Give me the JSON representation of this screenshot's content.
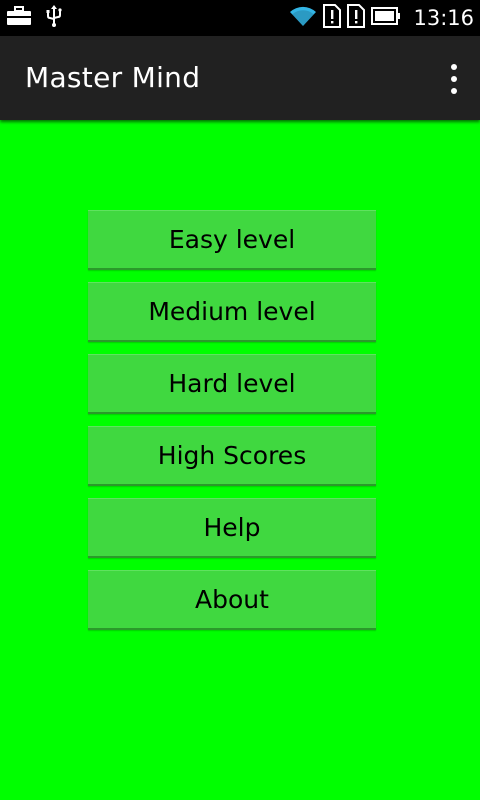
{
  "status_bar": {
    "time": "13:16",
    "left_icons": [
      "briefcase-icon",
      "usb-icon"
    ],
    "right_icons": [
      "wifi-icon",
      "sim-alert-icon",
      "sim-alert-icon",
      "battery-icon"
    ]
  },
  "action_bar": {
    "title": "Master Mind",
    "overflow_icon": "overflow-menu-icon"
  },
  "menu": {
    "items": [
      {
        "label": "Easy level"
      },
      {
        "label": "Medium level"
      },
      {
        "label": "Hard level"
      },
      {
        "label": "High Scores"
      },
      {
        "label": "Help"
      },
      {
        "label": "About"
      }
    ]
  },
  "colors": {
    "background": "#00ff00",
    "button": "#40d840",
    "action_bar": "#212121",
    "status_bar": "#000000",
    "wifi": "#33b5e5"
  }
}
